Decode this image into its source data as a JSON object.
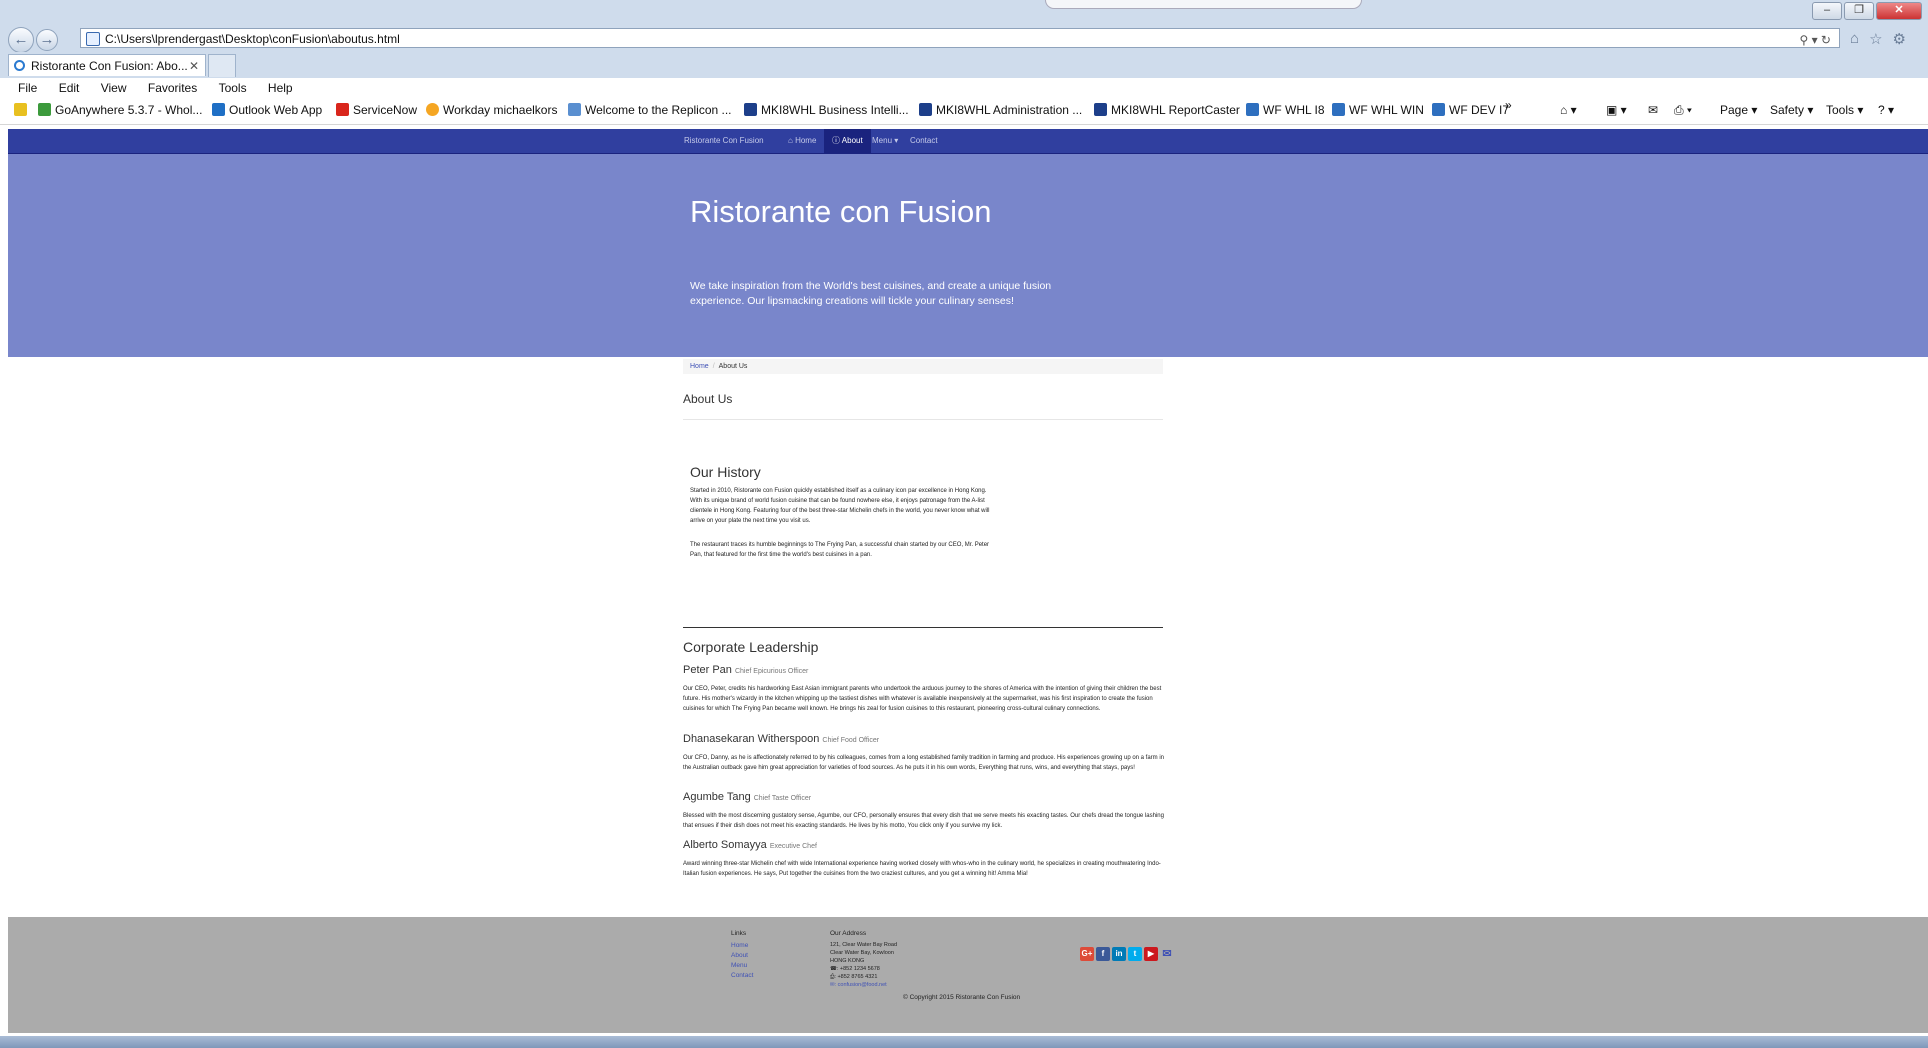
{
  "browser": {
    "address": "C:\\Users\\lprendergast\\Desktop\\conFusion\\aboutus.html",
    "tab_title": "Ristorante Con Fusion: Abo...",
    "menu": [
      "File",
      "Edit",
      "View",
      "Favorites",
      "Tools",
      "Help"
    ],
    "favorites": [
      "GoAnywhere 5.3.7 - Whol...",
      "Outlook Web App",
      "ServiceNow",
      "Workday michaelkors",
      "Welcome to the Replicon ...",
      "MKI8WHL Business Intelli...",
      "MKI8WHL Administration ...",
      "MKI8WHL ReportCaster",
      "WF WHL I8",
      "WF WHL WIN",
      "WF DEV I7"
    ],
    "commands": {
      "page": "Page",
      "safety": "Safety",
      "tools": "Tools"
    }
  },
  "nav": {
    "brand": "Ristorante Con Fusion",
    "home": "Home",
    "about": "About",
    "menu": "Menu",
    "contact": "Contact"
  },
  "jumbotron": {
    "title": "Ristorante con Fusion",
    "text": "We take inspiration from the World's best cuisines, and create a unique fusion experience. Our lipsmacking creations will tickle your culinary senses!"
  },
  "breadcrumb": {
    "home": "Home",
    "current": "About Us"
  },
  "about_heading": "About Us",
  "history": {
    "heading": "Our History",
    "p1": "Started in 2010, Ristorante con Fusion quickly established itself as a culinary icon par excellence in Hong Kong. With its unique brand of world fusion cuisine that can be found nowhere else, it enjoys patronage from the A-list clientele in Hong Kong. Featuring four of the best three-star Michelin chefs in the world, you never know what will arrive on your plate the next time you visit us.",
    "p2": "The restaurant traces its humble beginnings to The Frying Pan, a successful chain started by our CEO, Mr. Peter Pan, that featured for the first time the world's best cuisines in a pan."
  },
  "leadership": {
    "heading": "Corporate Leadership",
    "people": [
      {
        "name": "Peter Pan",
        "title": "Chief Epicurious Officer",
        "bio": "Our CEO, Peter, credits his hardworking East Asian immigrant parents who undertook the arduous journey to the shores of America with the intention of giving their children the best future. His mother's wizardy in the kitchen whipping up the tastiest dishes with whatever is available inexpensively at the supermarket, was his first inspiration to create the fusion cuisines for which The Frying Pan became well known. He brings his zeal for fusion cuisines to this restaurant, pioneering cross-cultural culinary connections."
      },
      {
        "name": "Dhanasekaran Witherspoon",
        "title": "Chief Food Officer",
        "bio": "Our CFO, Danny, as he is affectionately referred to by his colleagues, comes from a long established family tradition in farming and produce. His experiences growing up on a farm in the Australian outback gave him great appreciation for varieties of food sources. As he puts it in his own words, Everything that runs, wins, and everything that stays, pays!"
      },
      {
        "name": "Agumbe Tang",
        "title": "Chief Taste Officer",
        "bio": "Blessed with the most discerning gustatory sense, Agumbe, our CFO, personally ensures that every dish that we serve meets his exacting tastes. Our chefs dread the tongue lashing that ensues if their dish does not meet his exacting standards. He lives by his motto, You click only if you survive my lick."
      },
      {
        "name": "Alberto Somayya",
        "title": "Executive Chef",
        "bio": "Award winning three-star Michelin chef with wide International experience having worked closely with whos-who in the culinary world, he specializes in creating mouthwatering Indo-Italian fusion experiences. He says, Put together the cuisines from the two craziest cultures, and you get a winning hit! Amma Mia!"
      }
    ]
  },
  "footer": {
    "links_heading": "Links",
    "links": [
      "Home",
      "About",
      "Menu",
      "Contact"
    ],
    "address_heading": "Our Address",
    "address": [
      "121, Clear Water Bay Road",
      "Clear Water Bay, Kowloon",
      "HONG KONG",
      "☎: +852 1234 5678",
      "⎙: +852 8765 4321",
      "✉: confusion@food.net"
    ],
    "copyright": "© Copyright 2015 Ristorante Con Fusion"
  }
}
